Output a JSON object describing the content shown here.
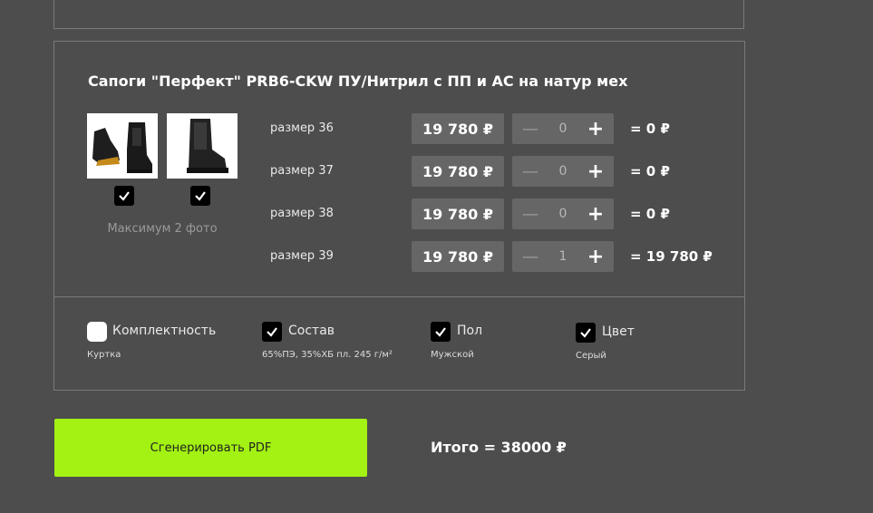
{
  "product": {
    "title": "Сапоги \"Перфект\" PRB6-CKW ПУ/Нитрил с ПП и АС на натур мех",
    "photos": [
      {
        "icon": "boot-photo-1",
        "selected": true
      },
      {
        "icon": "boot-photo-2",
        "selected": true
      }
    ],
    "max_photos_note": "Максимум 2 фото",
    "sizes": [
      {
        "label": "размер 36",
        "price": "19 780 ₽",
        "minus": "—",
        "qty": "0",
        "plus": "+",
        "total": "= 0 ₽"
      },
      {
        "label": "размер 37",
        "price": "19 780 ₽",
        "minus": "—",
        "qty": "0",
        "plus": "+",
        "total": "= 0 ₽"
      },
      {
        "label": "размер 38",
        "price": "19 780 ₽",
        "minus": "—",
        "qty": "0",
        "plus": "+",
        "total": "= 0 ₽"
      },
      {
        "label": "размер 39",
        "price": "19 780 ₽",
        "minus": "—",
        "qty": "1",
        "plus": "+",
        "total": "= 19 780 ₽"
      }
    ],
    "attributes": [
      {
        "label": "Комплектность",
        "value": "Куртка",
        "checked": false
      },
      {
        "label": "Состав",
        "value": "65%ПЭ, 35%ХБ пл. 245 г/м²",
        "checked": true
      },
      {
        "label": "Пол",
        "value": "Мужской",
        "checked": true
      },
      {
        "label": "Цвет",
        "value": "Серый",
        "checked": true
      }
    ]
  },
  "footer": {
    "generate_label": "Сгенерировать PDF",
    "total": "Итого = 38000 ₽"
  },
  "colors": {
    "background": "#4d4d4d",
    "field": "#666666",
    "accent": "#a3f213",
    "border": "#7a7a7a"
  }
}
